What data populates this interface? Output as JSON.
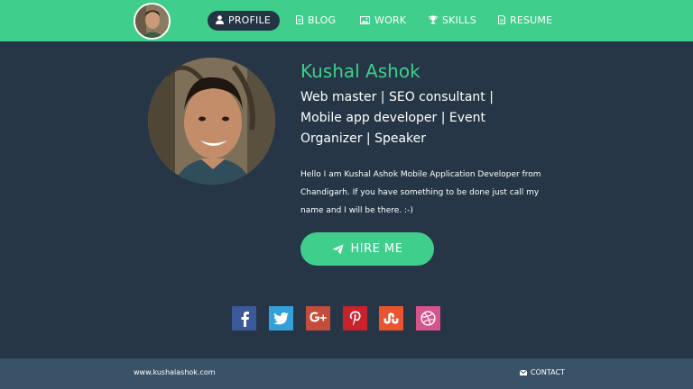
{
  "colors": {
    "accent": "#3fce8c",
    "background": "#263646",
    "footer": "#3a5268",
    "nav_active": "#233445"
  },
  "nav": {
    "avatar_icon": "user-avatar",
    "items": [
      {
        "label": "PROFILE",
        "icon": "user-icon",
        "active": true
      },
      {
        "label": "BLOG",
        "icon": "document-icon",
        "active": false
      },
      {
        "label": "WORK",
        "icon": "image-icon",
        "active": false
      },
      {
        "label": "SKILLS",
        "icon": "trophy-icon",
        "active": false
      },
      {
        "label": "RESUME",
        "icon": "file-icon",
        "active": false
      }
    ]
  },
  "profile": {
    "name": "Kushal Ashok",
    "tagline": "Web master | SEO consultant | Mobile app developer | Event Organizer | Speaker",
    "bio": "Hello I am Kushal Ashok Mobile Application Developer from Chandigarh. If you have something to be done just call my name and I will be there. :-)",
    "hire_button": "HIRE ME",
    "hire_icon": "paper-plane-icon"
  },
  "social": [
    {
      "name": "facebook",
      "icon": "facebook-icon",
      "color": "#3b5998"
    },
    {
      "name": "twitter",
      "icon": "twitter-icon",
      "color": "#33a1d8"
    },
    {
      "name": "google-plus",
      "icon": "google-plus-icon",
      "color": "#c34c3b"
    },
    {
      "name": "pinterest",
      "icon": "pinterest-icon",
      "color": "#c8232c"
    },
    {
      "name": "stumbleupon",
      "icon": "stumbleupon-icon",
      "color": "#e8542f"
    },
    {
      "name": "dribbble",
      "icon": "dribbble-icon",
      "color": "#d6548b"
    }
  ],
  "footer": {
    "url": "www.kushalashok.com",
    "contact_label": "CONTACT",
    "contact_icon": "envelope-icon"
  }
}
